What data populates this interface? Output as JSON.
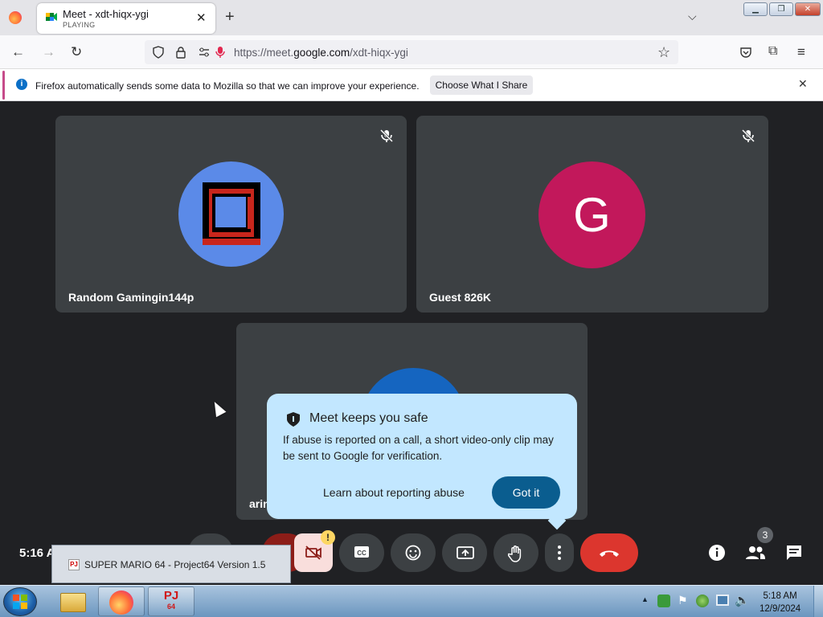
{
  "browser": {
    "tab_title": "Meet - xdt-hiqx-ygi",
    "tab_status": "PLAYING",
    "url_prefix": "https://meet.",
    "url_domain": "google.com",
    "url_path": "/xdt-hiqx-ygi",
    "notification": {
      "message": "Firefox automatically sends some data to Mozilla so that we can improve your experience.",
      "button": "Choose What I Share"
    }
  },
  "meet": {
    "participants": [
      {
        "name": "Random Gamingin144p",
        "avatar": "pixel-logo"
      },
      {
        "name": "Guest 826K",
        "initial": "G",
        "avatar_color": "#c2185b"
      },
      {
        "name": "arin"
      }
    ],
    "popup": {
      "title": "Meet keeps you safe",
      "body": "If abuse is reported on a call, a short video-only clip may be sent to Google for verification.",
      "learn_link": "Learn about reporting abuse",
      "got_it": "Got it"
    },
    "time": "5:16 A",
    "people_count": "3",
    "warning_badge": "!"
  },
  "taskbar": {
    "tooltip": "SUPER MARIO 64 - Project64 Version 1.5",
    "clock_time": "5:18 AM",
    "clock_date": "12/9/2024",
    "pj_label": "PJ",
    "pj_sub": "64"
  }
}
